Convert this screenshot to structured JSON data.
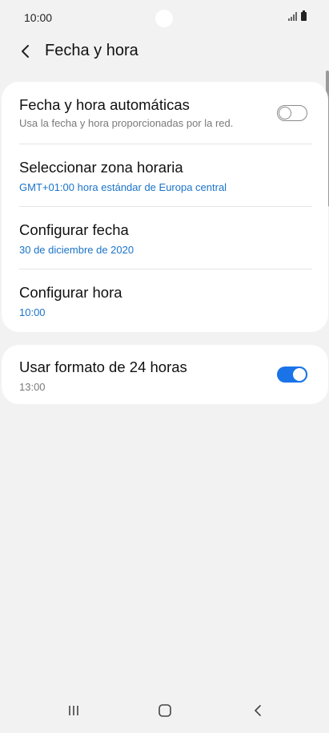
{
  "status_bar": {
    "time": "10:00"
  },
  "header": {
    "title": "Fecha y hora"
  },
  "settings": {
    "auto_datetime": {
      "title": "Fecha y hora automáticas",
      "subtitle": "Usa la fecha y hora proporcionadas por la red.",
      "enabled": false
    },
    "timezone": {
      "title": "Seleccionar zona horaria",
      "value": "GMT+01:00 hora estándar de Europa central"
    },
    "set_date": {
      "title": "Configurar fecha",
      "value": "30 de diciembre de 2020"
    },
    "set_time": {
      "title": "Configurar hora",
      "value": "10:00"
    },
    "format_24h": {
      "title": "Usar formato de 24 horas",
      "subtitle": "13:00",
      "enabled": true
    }
  },
  "colors": {
    "accent": "#1a73e8",
    "link": "#1a73c8",
    "background": "#f2f2f2"
  },
  "nav_bar": {
    "icons": [
      "recents-icon",
      "home-icon",
      "back-icon"
    ]
  }
}
